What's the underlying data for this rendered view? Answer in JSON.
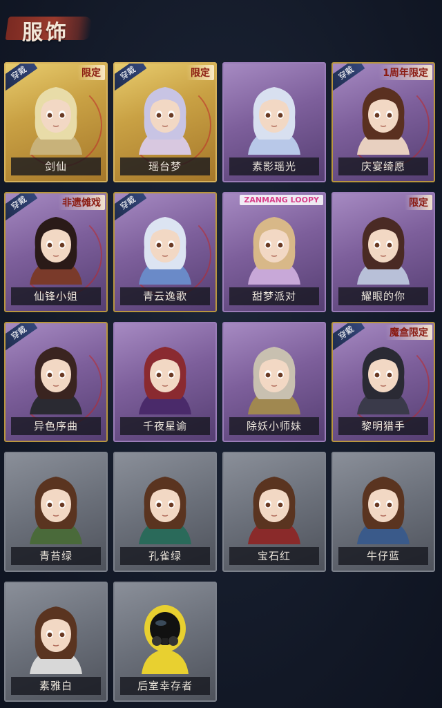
{
  "header": {
    "title": "服饰"
  },
  "colors": {
    "background": "#131a28",
    "title_brush": "#9a3a2d",
    "gold_frame": "#d6b25c",
    "purple_frame": "#9a7db8",
    "gray_frame": "#7c818b",
    "worn_badge": "#1d2a4a"
  },
  "cards": [
    {
      "name": "剑仙",
      "rarity": "gold",
      "worn_label": "穿戴",
      "tag": "限定",
      "hair": "#e8dca8",
      "cloth": "#c8b27a",
      "icon": "character-portrait"
    },
    {
      "name": "瑶台梦",
      "rarity": "gold",
      "worn_label": "穿戴",
      "tag": "限定",
      "hair": "#c8c4e4",
      "cloth": "#d8c8e0",
      "icon": "character-portrait"
    },
    {
      "name": "素影瑶光",
      "rarity": "purple",
      "worn_label": "",
      "tag": "",
      "hair": "#d8e0f0",
      "cloth": "#b8c8e8",
      "icon": "character-portrait"
    },
    {
      "name": "庆宴绮愿",
      "rarity": "purple",
      "worn_label": "穿戴",
      "tag": "1周年限定",
      "hair": "#5a3020",
      "cloth": "#e8d0c0",
      "icon": "character-portrait"
    },
    {
      "name": "仙锋小姐",
      "rarity": "purple",
      "worn_label": "穿戴",
      "tag": "非遗傩戏",
      "hair": "#2a1a18",
      "cloth": "#7a3a2a",
      "icon": "character-portrait"
    },
    {
      "name": "青云逸歌",
      "rarity": "purple",
      "worn_label": "穿戴",
      "tag": "",
      "hair": "#dce4f2",
      "cloth": "#6a8ac8",
      "icon": "character-portrait"
    },
    {
      "name": "甜梦派对",
      "rarity": "purple",
      "worn_label": "",
      "tag": "ZANMANG LOOPY",
      "hair": "#d8b888",
      "cloth": "#c8a8d8",
      "icon": "character-portrait"
    },
    {
      "name": "耀眼的你",
      "rarity": "purple",
      "worn_label": "",
      "tag": "限定",
      "hair": "#4a2a24",
      "cloth": "#b8c0d8",
      "icon": "character-portrait"
    },
    {
      "name": "异色序曲",
      "rarity": "purple",
      "worn_label": "穿戴",
      "tag": "",
      "hair": "#3a2420",
      "cloth": "#2a2a32",
      "icon": "character-portrait"
    },
    {
      "name": "千夜星谕",
      "rarity": "purple",
      "worn_label": "",
      "tag": "",
      "hair": "#8a2a30",
      "cloth": "#4a2a6a",
      "icon": "character-portrait"
    },
    {
      "name": "除妖小师妹",
      "rarity": "purple",
      "worn_label": "",
      "tag": "",
      "hair": "#c8c0b0",
      "cloth": "#a08850",
      "icon": "character-portrait"
    },
    {
      "name": "黎明猎手",
      "rarity": "purple",
      "worn_label": "穿戴",
      "tag": "魔盒限定",
      "hair": "#2a2a34",
      "cloth": "#3a3a4a",
      "icon": "character-portrait"
    },
    {
      "name": "青苔绿",
      "rarity": "gray",
      "worn_label": "",
      "tag": "",
      "hair": "#5a3420",
      "cloth": "#4a6a3a",
      "icon": "character-portrait"
    },
    {
      "name": "孔雀绿",
      "rarity": "gray",
      "worn_label": "",
      "tag": "",
      "hair": "#5a3420",
      "cloth": "#2a6a5a",
      "icon": "character-portrait"
    },
    {
      "name": "宝石红",
      "rarity": "gray",
      "worn_label": "",
      "tag": "",
      "hair": "#5a3420",
      "cloth": "#8a2a2a",
      "icon": "character-portrait"
    },
    {
      "name": "牛仔蓝",
      "rarity": "gray",
      "worn_label": "",
      "tag": "",
      "hair": "#5a3420",
      "cloth": "#3a5a8a",
      "icon": "character-portrait"
    },
    {
      "name": "素雅白",
      "rarity": "gray",
      "worn_label": "",
      "tag": "",
      "hair": "#5a3420",
      "cloth": "#d8d8d8",
      "icon": "character-portrait"
    },
    {
      "name": "后室幸存者",
      "rarity": "gray",
      "worn_label": "",
      "tag": "",
      "hair": "#1a1a1a",
      "cloth": "#e8d030",
      "icon": "hazmat-portrait"
    }
  ]
}
